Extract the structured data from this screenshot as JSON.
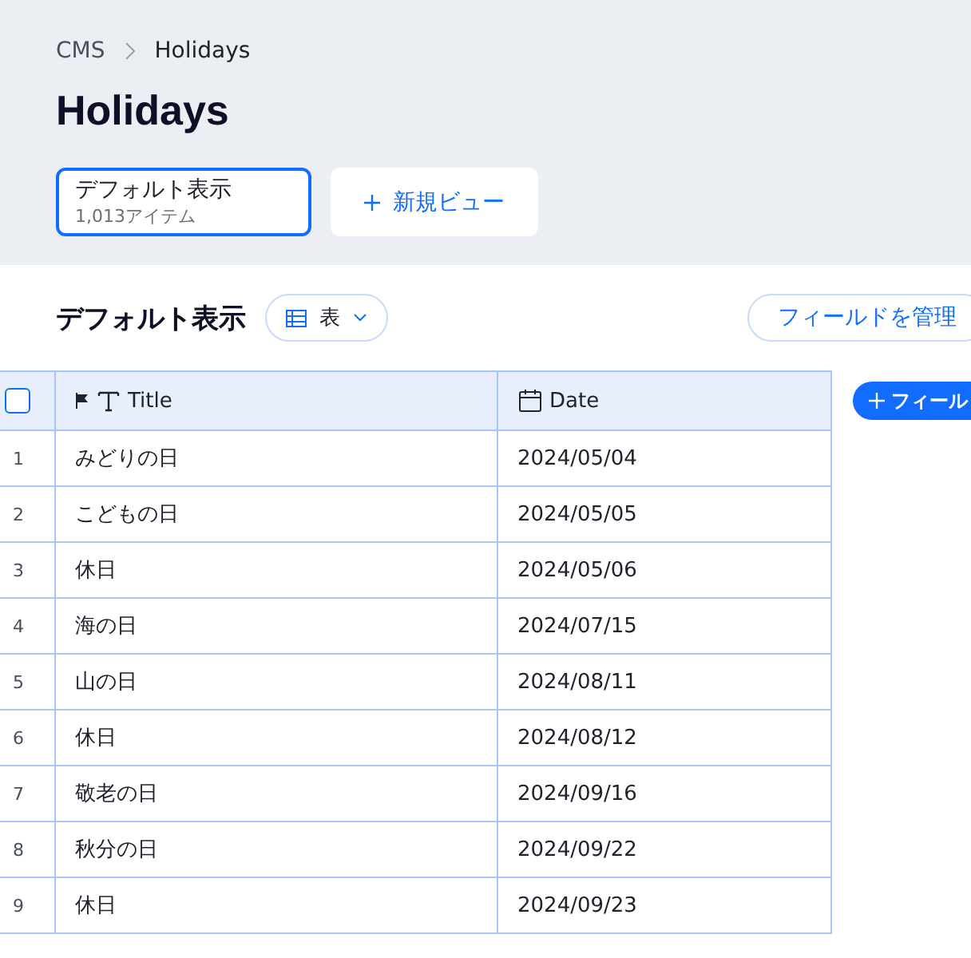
{
  "breadcrumb": [
    "CMS",
    "Holidays"
  ],
  "title": "Holidays",
  "views": [
    {
      "name": "デフォルト表示",
      "count": "1,013アイテム",
      "selected": true
    }
  ],
  "new_view_button": "新規ビュー",
  "section": {
    "title": "デフォルト表示",
    "layout_dropdown": "表",
    "manage_fields_button": "フィールドを管理"
  },
  "table": {
    "select_all_checked": false,
    "columns": [
      {
        "kind": "text",
        "label": "Title",
        "primary": true
      },
      {
        "kind": "date",
        "label": "Date",
        "primary": false
      }
    ],
    "add_field_button": "フィール",
    "rows": [
      {
        "number": "1",
        "cells": [
          "みどりの日",
          "2024/05/04"
        ]
      },
      {
        "number": "2",
        "cells": [
          "こどもの日",
          "2024/05/05"
        ]
      },
      {
        "number": "3",
        "cells": [
          "休日",
          "2024/05/06"
        ]
      },
      {
        "number": "4",
        "cells": [
          "海の日",
          "2024/07/15"
        ]
      },
      {
        "number": "5",
        "cells": [
          "山の日",
          "2024/08/11"
        ]
      },
      {
        "number": "6",
        "cells": [
          "休日",
          "2024/08/12"
        ]
      },
      {
        "number": "7",
        "cells": [
          "敬老の日",
          "2024/09/16"
        ]
      },
      {
        "number": "8",
        "cells": [
          "秋分の日",
          "2024/09/22"
        ]
      },
      {
        "number": "9",
        "cells": [
          "休日",
          "2024/09/23"
        ]
      }
    ]
  }
}
